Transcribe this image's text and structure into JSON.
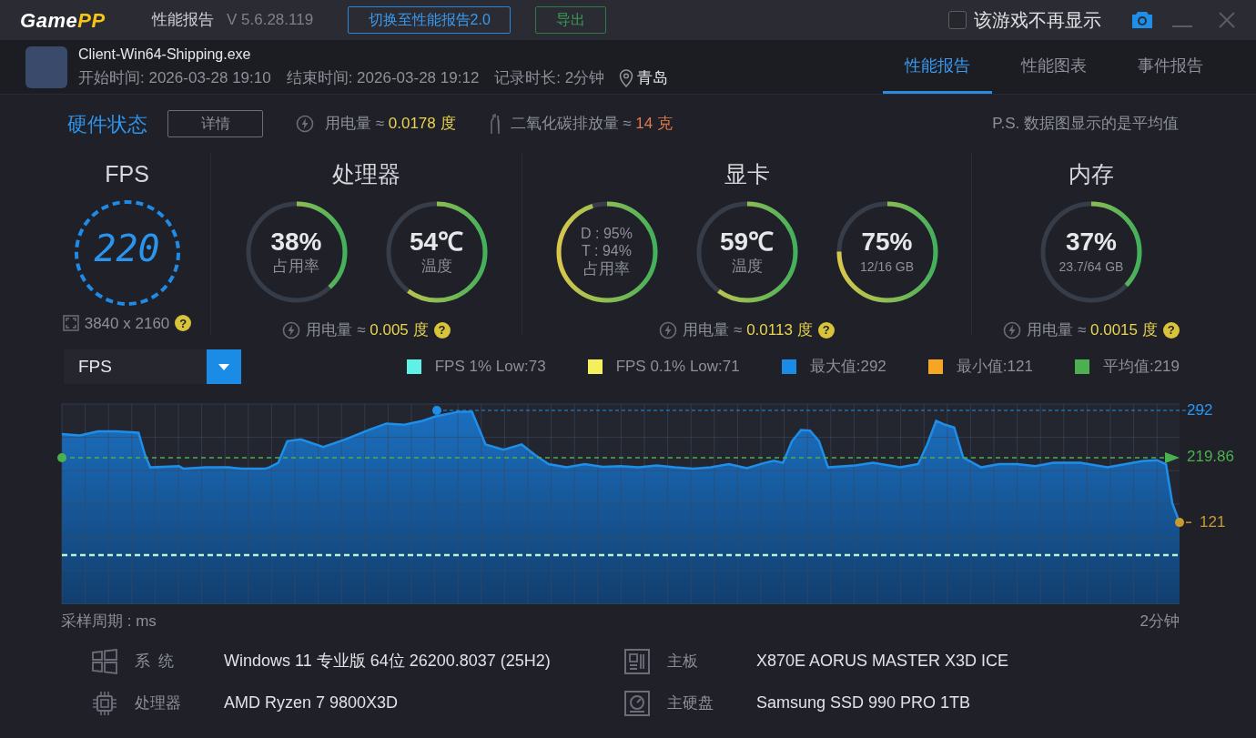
{
  "title_bar": {
    "logo_main": "Game",
    "logo_accent": "PP",
    "title": "性能报告",
    "version": "V 5.6.28.119",
    "switch_button": "切换至性能报告2.0",
    "export_button": "导出",
    "hide_checkbox": {
      "label": "该游戏不再显示",
      "checked": false
    }
  },
  "session": {
    "exe": "Client-Win64-Shipping.exe",
    "start": "开始时间: 2026-03-28 19:10",
    "end": "结束时间: 2026-03-28 19:12",
    "duration": "记录时长: 2分钟",
    "location": "青岛"
  },
  "tabs": [
    {
      "label": "性能报告",
      "selected": true
    },
    {
      "label": "性能图表",
      "selected": false
    },
    {
      "label": "事件报告",
      "selected": false
    }
  ],
  "hardware_status": {
    "title": "硬件状态",
    "details_button": "详情",
    "power_label": "用电量 ≈",
    "power_value": "0.0178 度",
    "co2_label": "二氧化碳排放量 ≈",
    "co2_value": "14 克",
    "note": "P.S. 数据图显示的是平均值"
  },
  "panels": [
    {
      "kind": "fps",
      "title": "FPS",
      "fps": "220",
      "resolution": "3840 x 2160",
      "help": "?"
    },
    {
      "kind": "gauges",
      "title": "处理器",
      "gauges": [
        {
          "kind": "single",
          "value": "38%",
          "label": "占用率",
          "level": 0.38
        },
        {
          "kind": "single",
          "value": "54℃",
          "label": "温度",
          "level": 0.6
        }
      ],
      "power_label": "用电量 ≈",
      "power_value": "0.005 度",
      "help": "?"
    },
    {
      "kind": "gauges",
      "title": "显卡",
      "gauges": [
        {
          "kind": "dual",
          "lines": [
            "D : 95%",
            "T : 94%"
          ],
          "label": "占用率",
          "level": 0.95
        },
        {
          "kind": "single",
          "value": "59℃",
          "label": "温度",
          "level": 0.6
        },
        {
          "kind": "single",
          "value": "75%",
          "label": "12/16 GB",
          "level": 0.75
        }
      ],
      "power_label": "用电量 ≈",
      "power_value": "0.0113 度",
      "help": "?"
    },
    {
      "kind": "gauges",
      "title": "内存",
      "gauges": [
        {
          "kind": "single",
          "value": "37%",
          "label": "23.7/64 GB",
          "level": 0.37
        }
      ],
      "power_label": "用电量 ≈",
      "power_value": "0.0015 度",
      "help": "?"
    }
  ],
  "chart": {
    "metric_select": "FPS",
    "legend": [
      {
        "label": "FPS 1% Low:73",
        "color": "#5ef2e6"
      },
      {
        "label": "FPS 0.1% Low:71",
        "color": "#f4f05c"
      },
      {
        "label": "最大值:292",
        "color": "#1b8ce6"
      },
      {
        "label": "最小值:121",
        "color": "#f5a623"
      },
      {
        "label": "平均值:219",
        "color": "#4caf50"
      }
    ],
    "max_label": "292",
    "avg_label": "219.86",
    "min_label": "121",
    "x_left": "采样周期 : ms",
    "x_right": "2分钟"
  },
  "system_info": [
    {
      "label": "系  统",
      "value": "Windows 11 专业版 64位 26200.8037 (25H2)"
    },
    {
      "label": "主板",
      "value": "X870E AORUS MASTER X3D ICE"
    },
    {
      "label": "处理器",
      "value": "AMD Ryzen 7 9800X3D"
    },
    {
      "label": "主硬盘",
      "value": "Samsung SSD 990 PRO 1TB"
    }
  ]
}
